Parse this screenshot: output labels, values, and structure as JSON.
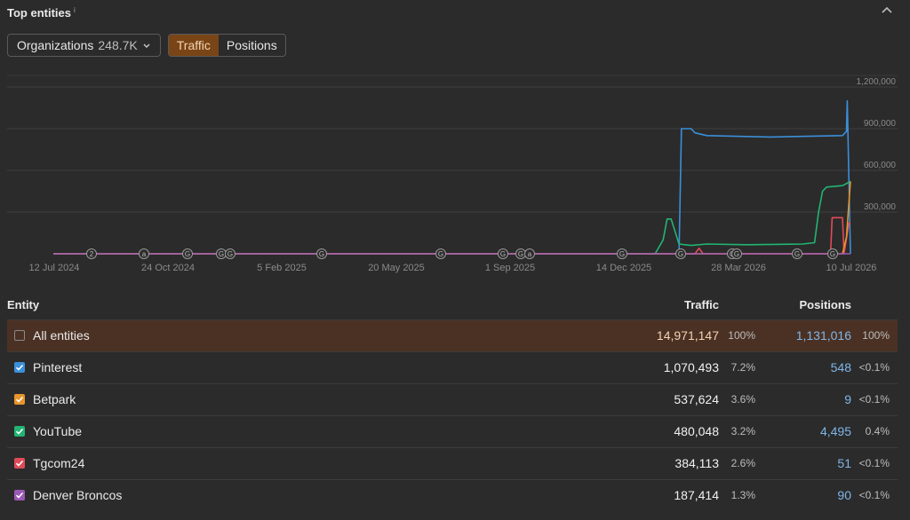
{
  "header": {
    "title": "Top entities",
    "info": "i"
  },
  "controls": {
    "dropdown_label": "Organizations",
    "dropdown_count": "248.7K",
    "tabs": [
      "Traffic",
      "Positions"
    ],
    "active_tab": "Traffic"
  },
  "chart_data": {
    "type": "line",
    "x_ticks": [
      "12 Jul 2024",
      "24 Oct 2024",
      "5 Feb 2025",
      "20 May 2025",
      "1 Sep 2025",
      "14 Dec 2025",
      "28 Mar 2026",
      "10 Jul 2026"
    ],
    "y_ticks": [
      "1,200,000",
      "900,000",
      "600,000",
      "300,000"
    ],
    "ylim": [
      0,
      1200000
    ],
    "markers": [
      "2",
      "a",
      "G",
      "G",
      "G",
      "G",
      "G",
      "G",
      "G",
      "a",
      "G",
      "G",
      "G",
      "G",
      "G",
      "G"
    ],
    "series": [
      {
        "color": "#3b8fd9",
        "points": [
          [
            0,
            0
          ],
          [
            0.785,
            0
          ],
          [
            0.788,
            900000
          ],
          [
            0.8,
            900000
          ],
          [
            0.805,
            870000
          ],
          [
            0.82,
            850000
          ],
          [
            0.9,
            840000
          ],
          [
            0.99,
            850000
          ],
          [
            0.995,
            880000
          ],
          [
            0.996,
            1100000
          ],
          [
            1.0,
            0
          ]
        ]
      },
      {
        "color": "#22b573",
        "points": [
          [
            0,
            0
          ],
          [
            0.755,
            0
          ],
          [
            0.765,
            100000
          ],
          [
            0.77,
            250000
          ],
          [
            0.775,
            250000
          ],
          [
            0.785,
            70000
          ],
          [
            0.8,
            60000
          ],
          [
            0.82,
            70000
          ],
          [
            0.87,
            65000
          ],
          [
            0.94,
            70000
          ],
          [
            0.955,
            80000
          ],
          [
            0.96,
            300000
          ],
          [
            0.965,
            450000
          ],
          [
            0.97,
            480000
          ],
          [
            0.99,
            490000
          ],
          [
            1.0,
            520000
          ]
        ]
      },
      {
        "color": "#e04b59",
        "points": [
          [
            0,
            0
          ],
          [
            0.805,
            0
          ],
          [
            0.81,
            40000
          ],
          [
            0.815,
            0
          ],
          [
            0.975,
            0
          ],
          [
            0.977,
            260000
          ],
          [
            0.99,
            260000
          ],
          [
            0.992,
            0
          ],
          [
            0.998,
            220000
          ],
          [
            1.0,
            220000
          ]
        ]
      },
      {
        "color": "#e8952b",
        "points": [
          [
            0,
            0
          ],
          [
            0.99,
            0
          ],
          [
            0.995,
            120000
          ],
          [
            1.0,
            520000
          ]
        ]
      },
      {
        "color": "#9b59b6",
        "points": [
          [
            0,
            0
          ],
          [
            1.0,
            0
          ]
        ]
      }
    ]
  },
  "table": {
    "headers": {
      "entity": "Entity",
      "traffic": "Traffic",
      "positions": "Positions"
    },
    "rows": [
      {
        "name": "All entities",
        "traffic": "14,971,147",
        "traffic_pct": "100%",
        "positions": "1,131,016",
        "positions_pct": "100%",
        "checked": false,
        "color": ""
      },
      {
        "name": "Pinterest",
        "traffic": "1,070,493",
        "traffic_pct": "7.2%",
        "positions": "548",
        "positions_pct": "<0.1%",
        "checked": true,
        "color": "#3b8fd9"
      },
      {
        "name": "Betpark",
        "traffic": "537,624",
        "traffic_pct": "3.6%",
        "positions": "9",
        "positions_pct": "<0.1%",
        "checked": true,
        "color": "#e8952b"
      },
      {
        "name": "YouTube",
        "traffic": "480,048",
        "traffic_pct": "3.2%",
        "positions": "4,495",
        "positions_pct": "0.4%",
        "checked": true,
        "color": "#22b573"
      },
      {
        "name": "Tgcom24",
        "traffic": "384,113",
        "traffic_pct": "2.6%",
        "positions": "51",
        "positions_pct": "<0.1%",
        "checked": true,
        "color": "#e04b59"
      },
      {
        "name": "Denver Broncos",
        "traffic": "187,414",
        "traffic_pct": "1.3%",
        "positions": "90",
        "positions_pct": "<0.1%",
        "checked": true,
        "color": "#9b59b6"
      }
    ]
  }
}
